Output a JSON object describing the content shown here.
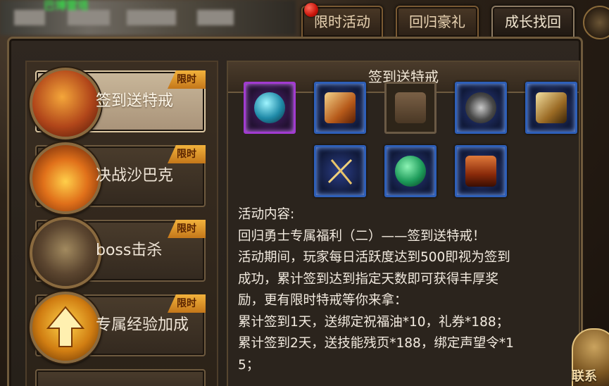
{
  "header": {
    "blurred_title": "巴博雷塔"
  },
  "tabs": [
    {
      "label": "限时活动",
      "has_notification": true
    },
    {
      "label": "回归豪礼",
      "has_notification": false
    },
    {
      "label": "成长找回",
      "has_notification": false
    }
  ],
  "sidebar": {
    "items": [
      {
        "label": "签到送特戒",
        "badge": "限时",
        "active": true,
        "icon": "treasure-bag-icon"
      },
      {
        "label": "决战沙巴克",
        "badge": "限时",
        "active": false,
        "icon": "castle-battle-icon"
      },
      {
        "label": "boss击杀",
        "badge": "限时",
        "active": false,
        "icon": "boss-monster-icon"
      },
      {
        "label": "专属经验加成",
        "badge": "限时",
        "active": false,
        "icon": "up-arrow-icon"
      }
    ]
  },
  "content": {
    "title": "签到送特戒",
    "reward_rows": [
      [
        "blue-orb-icon",
        "scroll-icon",
        "paper-icon",
        "ring-icon",
        "chest-icon"
      ],
      [
        "crossed-swords-icon",
        "green-orb-icon",
        "treasure-chest-icon"
      ]
    ],
    "description_lines": [
      "活动内容:",
      "回归勇士专属福利（二）——签到送特戒！",
      "活动期间，玩家每日活跃度达到500即视为签到",
      "成功，累计签到达到指定天数即可获得丰厚奖",
      "励，更有限时特戒等你来拿：",
      "累计签到1天，送绑定祝福油*10，礼券*188；",
      "累计签到2天，送技能残页*188，绑定声望令*1",
      "5；"
    ]
  },
  "corner_button": {
    "label": "联系"
  }
}
